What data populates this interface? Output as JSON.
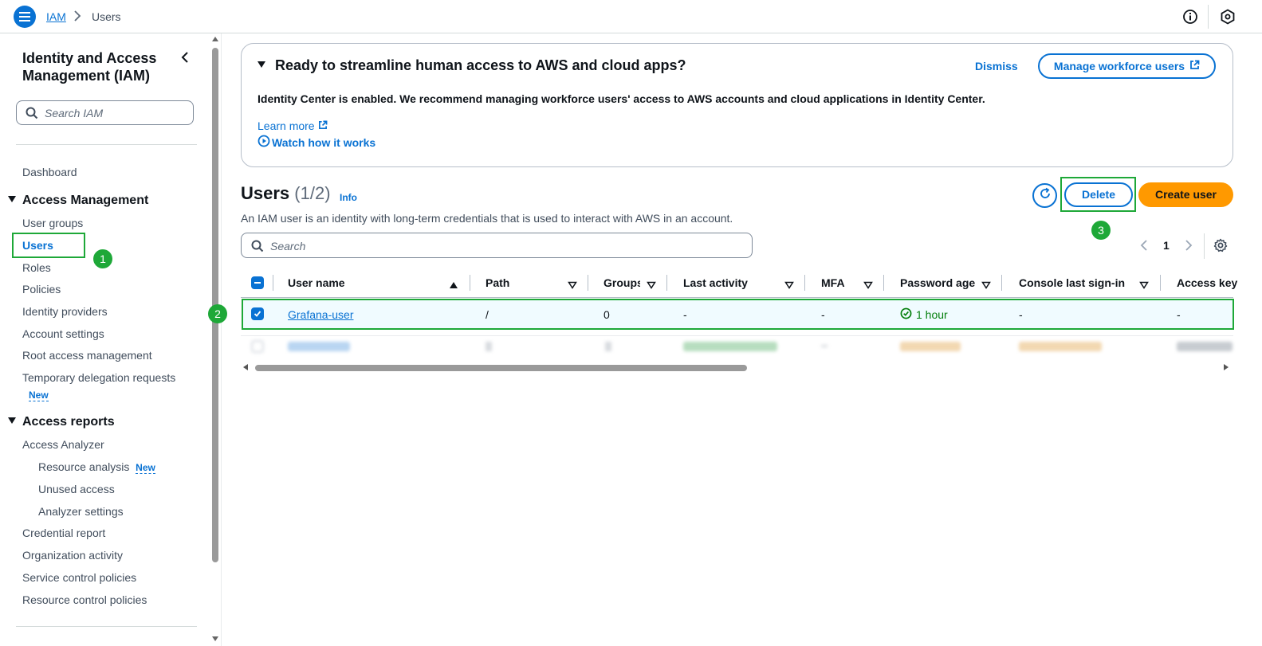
{
  "header": {
    "breadcrumb_root": "IAM",
    "breadcrumb_current": "Users"
  },
  "sidebar": {
    "title": "Identity and Access Management (IAM)",
    "search_placeholder": "Search IAM",
    "dashboard": "Dashboard",
    "access_management": "Access Management",
    "am_items": [
      "User groups",
      "Users",
      "Roles",
      "Policies",
      "Identity providers",
      "Account settings",
      "Root access management",
      "Temporary delegation requests"
    ],
    "new_badge": "New",
    "access_reports": "Access reports",
    "access_analyzer": "Access Analyzer",
    "analyzer_items": [
      "Resource analysis",
      "Unused access",
      "Analyzer settings"
    ],
    "ar_items": [
      "Credential report",
      "Organization activity",
      "Service control policies",
      "Resource control policies"
    ]
  },
  "annotations": {
    "m1": "1",
    "m2": "2",
    "m3": "3"
  },
  "banner": {
    "title": "Ready to streamline human access to AWS and cloud apps?",
    "dismiss": "Dismiss",
    "manage_button": "Manage workforce users",
    "body": "Identity Center is enabled. We recommend managing workforce users' access to AWS accounts and cloud applications in Identity Center.",
    "learn_more": "Learn more",
    "watch": "Watch how it works"
  },
  "users": {
    "title": "Users",
    "count": "(1/2)",
    "info": "Info",
    "description": "An IAM user is an identity with long-term credentials that is used to interact with AWS in an account.",
    "delete_button": "Delete",
    "create_button": "Create user",
    "search_placeholder": "Search",
    "page": "1"
  },
  "table": {
    "columns": [
      "User name",
      "Path",
      "Groups",
      "Last activity",
      "MFA",
      "Password age",
      "Console last sign-in",
      "Access key"
    ],
    "rows": [
      {
        "user_name": "Grafana-user",
        "path": "/",
        "groups": "0",
        "last_activity": "-",
        "mfa": "-",
        "password_age": "1 hour",
        "console_last_sign_in": "-",
        "access_key": "-",
        "selected": true
      }
    ]
  },
  "colors": {
    "accent": "#0972d3",
    "primary_button": "#ff9900",
    "annotation": "#1ea838",
    "success": "#037f0c"
  }
}
